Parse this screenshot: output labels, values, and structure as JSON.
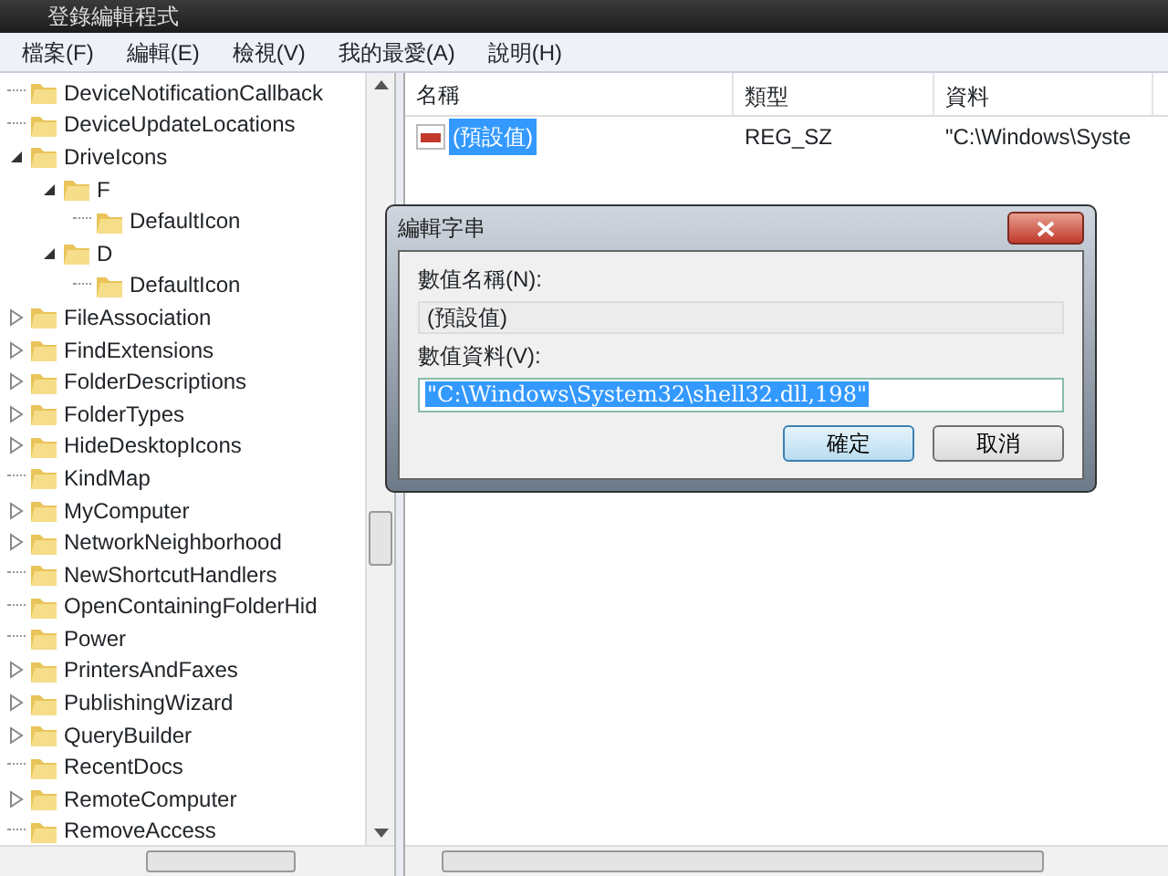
{
  "window": {
    "title": "登錄編輯程式"
  },
  "menu": [
    {
      "label": "檔案(F)"
    },
    {
      "label": "編輯(E)"
    },
    {
      "label": "檢視(V)"
    },
    {
      "label": "我的最愛(A)"
    },
    {
      "label": "說明(H)"
    }
  ],
  "tree": [
    {
      "label": "DeviceNotificationCallback",
      "kind": "leaf"
    },
    {
      "label": "DeviceUpdateLocations",
      "kind": "leaf"
    },
    {
      "label": "DriveIcons",
      "kind": "expanded",
      "children": [
        {
          "label": "F",
          "kind": "expanded",
          "children": [
            {
              "label": "DefaultIcon",
              "kind": "leaf"
            }
          ]
        },
        {
          "label": "D",
          "kind": "expanded",
          "children": [
            {
              "label": "DefaultIcon",
              "kind": "leaf"
            }
          ]
        }
      ]
    },
    {
      "label": "FileAssociation",
      "kind": "collapsed"
    },
    {
      "label": "FindExtensions",
      "kind": "collapsed"
    },
    {
      "label": "FolderDescriptions",
      "kind": "collapsed"
    },
    {
      "label": "FolderTypes",
      "kind": "collapsed"
    },
    {
      "label": "HideDesktopIcons",
      "kind": "collapsed"
    },
    {
      "label": "KindMap",
      "kind": "leaf"
    },
    {
      "label": "MyComputer",
      "kind": "collapsed"
    },
    {
      "label": "NetworkNeighborhood",
      "kind": "collapsed"
    },
    {
      "label": "NewShortcutHandlers",
      "kind": "leaf"
    },
    {
      "label": "OpenContainingFolderHid",
      "kind": "leaf"
    },
    {
      "label": "Power",
      "kind": "leaf"
    },
    {
      "label": "PrintersAndFaxes",
      "kind": "collapsed"
    },
    {
      "label": "PublishingWizard",
      "kind": "collapsed"
    },
    {
      "label": "QueryBuilder",
      "kind": "collapsed"
    },
    {
      "label": "RecentDocs",
      "kind": "leaf"
    },
    {
      "label": "RemoteComputer",
      "kind": "collapsed"
    },
    {
      "label": "RemoveAccess",
      "kind": "leaf"
    }
  ],
  "list": {
    "columns": [
      "名稱",
      "類型",
      "資料"
    ],
    "rows": [
      {
        "cells": [
          "(預設值)",
          "REG_SZ",
          "\"C:\\Windows\\Syste"
        ],
        "selected": true
      }
    ]
  },
  "dialog": {
    "title": "編輯字串",
    "name_label": "數值名稱(N):",
    "name_value": "(預設值)",
    "data_label": "數值資料(V):",
    "data_value": "\"C:\\Windows\\System32\\shell32.dll,198\"",
    "data_selected": true,
    "buttons": [
      {
        "label": "確定",
        "default": true
      },
      {
        "label": "取消",
        "default": false
      }
    ]
  }
}
